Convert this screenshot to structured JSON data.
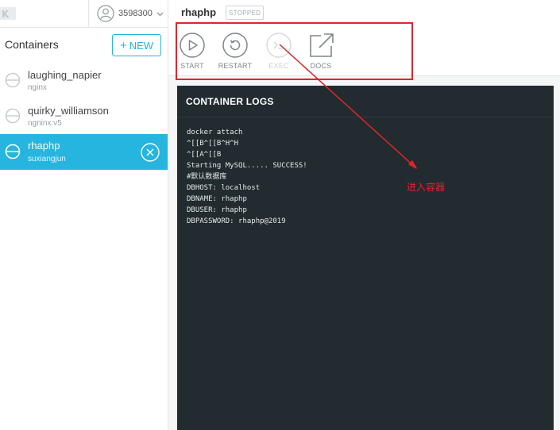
{
  "app": {
    "account_name": "3598300"
  },
  "sidebar": {
    "title": "Containers",
    "new_button_label": "NEW",
    "containers": [
      {
        "name": "laughing_napier",
        "image": "nginx",
        "active": false
      },
      {
        "name": "quirky_williamson",
        "image": "ngninx:v5",
        "active": false
      },
      {
        "name": "rhaphp",
        "image": "suxiangjun",
        "active": true
      }
    ]
  },
  "container": {
    "name": "rhaphp",
    "status": "STOPPED",
    "actions": {
      "start": "START",
      "restart": "RESTART",
      "exec": "EXEC",
      "docs": "DOCS"
    }
  },
  "logs": {
    "title": "CONTAINER LOGS",
    "lines": [
      "docker attach",
      "^[[B^[[B^H^H",
      "^[[A^[[B",
      "Starting MySQL..... SUCCESS!",
      "#默认数据库",
      "DBHOST: localhost",
      "DBNAME: rhaphp",
      "DBUSER: rhaphp",
      "DBPASSWORD: rhaphp@2019"
    ]
  },
  "annotation": {
    "text": "进入容器",
    "color": "#e0252a"
  },
  "colors": {
    "accent": "#25b5df",
    "log_bg": "#222b30"
  }
}
